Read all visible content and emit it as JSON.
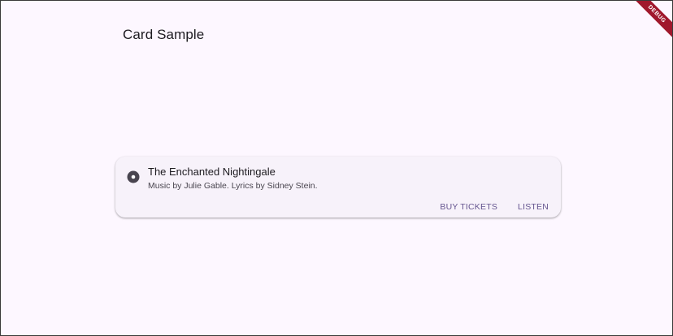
{
  "app": {
    "title": "Card Sample",
    "debug_label": "DEBUG"
  },
  "card": {
    "icon": "album-icon",
    "title": "The Enchanted Nightingale",
    "subtitle": "Music by Julie Gable. Lyrics by Sidney Stein.",
    "actions": [
      {
        "label": "BUY TICKETS"
      },
      {
        "label": "LISTEN"
      }
    ]
  },
  "colors": {
    "background": "#fdf7ff",
    "card": "#f7f2fa",
    "accent": "#65558f",
    "debug_banner": "#a0182c"
  }
}
